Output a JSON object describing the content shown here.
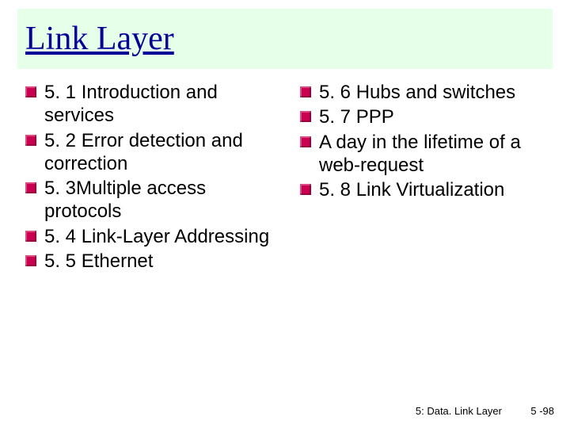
{
  "title": "Link Layer",
  "columns": {
    "left": [
      "5. 1 Introduction and services",
      "5. 2 Error detection and correction",
      "5. 3Multiple access protocols",
      "5. 4 Link-Layer Addressing",
      "5. 5 Ethernet"
    ],
    "right": [
      "5. 6 Hubs and switches",
      "5. 7 PPP",
      "A day in the lifetime of a web-request",
      "5. 8 Link Virtualization"
    ]
  },
  "footer": {
    "chapter": "5: Data. Link Layer",
    "page": "5 -98"
  }
}
